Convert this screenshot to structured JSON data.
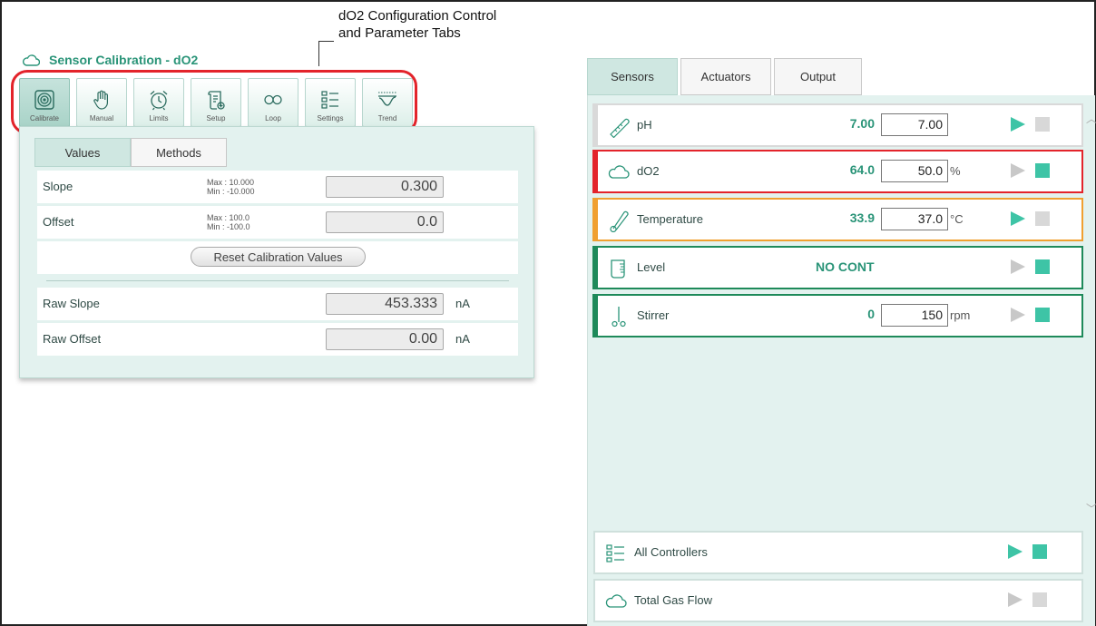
{
  "annotation": {
    "line1": "dO2 Configuration Control",
    "line2": "and Parameter Tabs"
  },
  "panel": {
    "title": "Sensor Calibration - ",
    "title_param": "dO2"
  },
  "toolbar": [
    {
      "label": "Calibrate",
      "icon": "calibrate-target-icon"
    },
    {
      "label": "Manual",
      "icon": "hand-icon"
    },
    {
      "label": "Limits",
      "icon": "alarm-clock-icon"
    },
    {
      "label": "Setup",
      "icon": "setup-scroll-icon"
    },
    {
      "label": "Loop",
      "icon": "loop-infinity-icon"
    },
    {
      "label": "Settings",
      "icon": "settings-checklist-icon"
    },
    {
      "label": "Trend",
      "icon": "trend-chart-icon"
    }
  ],
  "subtabs": {
    "values": "Values",
    "methods": "Methods"
  },
  "calibration": {
    "slope": {
      "label": "Slope",
      "max": "Max  : 10.000",
      "min": "Min   : -10.000",
      "value": "0.300"
    },
    "offset": {
      "label": "Offset",
      "max": "Max  : 100.0",
      "min": "Min   : -100.0",
      "value": "0.0"
    },
    "reset_label": "Reset Calibration Values",
    "raw_slope": {
      "label": "Raw Slope",
      "value": "453.333",
      "unit": "nA"
    },
    "raw_offset": {
      "label": "Raw Offset",
      "value": "0.00",
      "unit": "nA"
    }
  },
  "right_tabs": {
    "sensors": "Sensors",
    "actuators": "Actuators",
    "output": "Output"
  },
  "sensors": [
    {
      "name": "pH",
      "pv": "7.00",
      "sp": "7.00",
      "unit": "",
      "border": "#d9d9d9",
      "icon": "thermometer-probe-icon"
    },
    {
      "name": "dO2",
      "pv": "64.0",
      "sp": "50.0",
      "unit": "%",
      "border": "#e3242b",
      "icon": "cloud-icon"
    },
    {
      "name": "Temperature",
      "pv": "33.9",
      "sp": "37.0",
      "unit": "°C",
      "border": "#f0a030",
      "icon": "temperature-probe-icon"
    },
    {
      "name": "Level",
      "status": "NO CONT",
      "border": "#1e8a5a",
      "icon": "level-vessel-icon"
    },
    {
      "name": "Stirrer",
      "pv": "0",
      "sp": "150",
      "unit": "rpm",
      "border": "#1e8a5a",
      "icon": "stirrer-icon"
    }
  ],
  "bottom": {
    "all_controllers": "All Controllers",
    "total_gas_flow": "Total Gas Flow"
  },
  "colors": {
    "accent": "#2a9478",
    "active_green": "#3ec4a6",
    "alarm_red": "#e3242b",
    "warn_orange": "#f0a030"
  }
}
